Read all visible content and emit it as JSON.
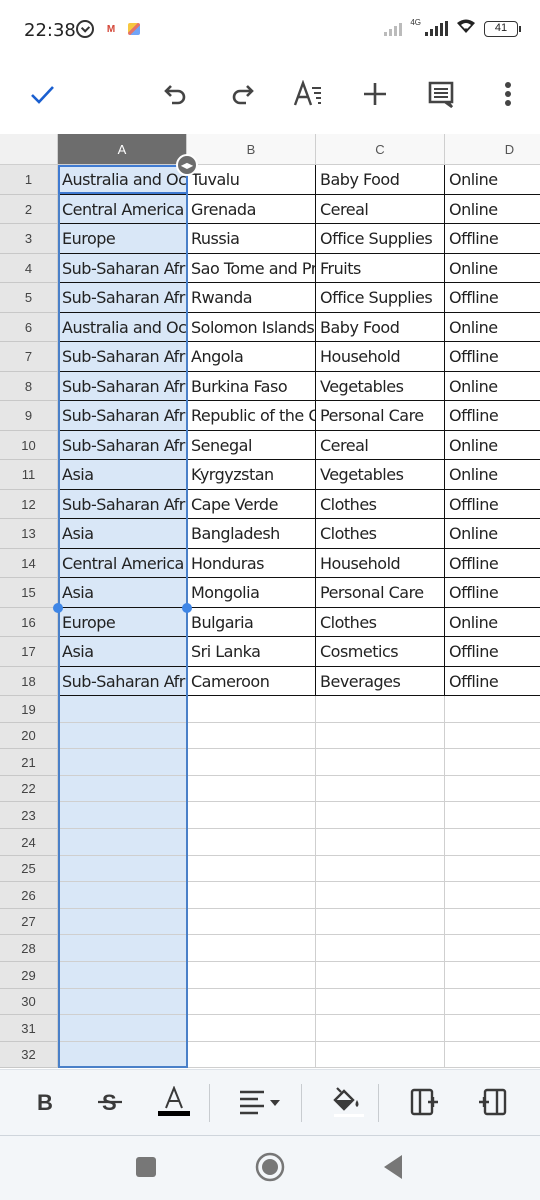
{
  "status_bar": {
    "time": "22:38",
    "network_label": "4G",
    "battery": "41",
    "icons": [
      "alarm-icon",
      "gmail-icon",
      "photos-icon",
      "signal-off-icon",
      "signal-4g-icon",
      "wifi-icon",
      "battery-icon"
    ]
  },
  "toolbar": {
    "icons": [
      "check-icon",
      "undo-icon",
      "redo-icon",
      "text-format-icon",
      "insert-plus-icon",
      "comment-icon",
      "more-vert-icon"
    ]
  },
  "sheet": {
    "columns": [
      "A",
      "B",
      "C",
      "D"
    ],
    "selected_column": "A",
    "row_numbers": [
      "1",
      "2",
      "3",
      "4",
      "5",
      "6",
      "7",
      "8",
      "9",
      "10",
      "11",
      "12",
      "13",
      "14",
      "15",
      "16",
      "17",
      "18",
      "19",
      "20",
      "21",
      "22",
      "23",
      "24",
      "25",
      "26",
      "27",
      "28",
      "29",
      "30",
      "31",
      "32"
    ],
    "rows": [
      [
        "Australia and Oce",
        "Tuvalu",
        "Baby Food",
        "Online"
      ],
      [
        "Central America a",
        "Grenada",
        "Cereal",
        "Online"
      ],
      [
        "Europe",
        "Russia",
        "Office Supplies",
        "Offline"
      ],
      [
        "Sub-Saharan Afric",
        "Sao Tome and Pri",
        "Fruits",
        "Online"
      ],
      [
        "Sub-Saharan Afric",
        "Rwanda",
        "Office Supplies",
        "Offline"
      ],
      [
        "Australia and Oce",
        "Solomon Islands",
        "Baby Food",
        "Online"
      ],
      [
        "Sub-Saharan Afric",
        "Angola",
        "Household",
        "Offline"
      ],
      [
        "Sub-Saharan Afric",
        "Burkina Faso",
        "Vegetables",
        "Online"
      ],
      [
        "Sub-Saharan Afric",
        "Republic of the Co",
        "Personal Care",
        "Offline"
      ],
      [
        "Sub-Saharan Afric",
        "Senegal",
        "Cereal",
        "Online"
      ],
      [
        "Asia",
        "Kyrgyzstan",
        "Vegetables",
        "Online"
      ],
      [
        "Sub-Saharan Afric",
        "Cape Verde",
        "Clothes",
        "Offline"
      ],
      [
        "Asia",
        "Bangladesh",
        "Clothes",
        "Online"
      ],
      [
        "Central America a",
        "Honduras",
        "Household",
        "Offline"
      ],
      [
        "Asia",
        "Mongolia",
        "Personal Care",
        "Offline"
      ],
      [
        "Europe",
        "Bulgaria",
        "Clothes",
        "Online"
      ],
      [
        "Asia",
        "Sri Lanka",
        "Cosmetics",
        "Offline"
      ],
      [
        "Sub-Saharan Afric",
        "Cameroon",
        "Beverages",
        "Offline"
      ]
    ]
  },
  "format_bar": {
    "icons": [
      "bold-icon",
      "strikethrough-icon",
      "text-color-icon",
      "align-icon",
      "fill-color-icon",
      "insert-column-right-icon",
      "insert-column-left-icon"
    ],
    "text_color": "#000000",
    "fill_color": "#ffffff"
  },
  "nav_bar": {
    "icons": [
      "recents-icon",
      "home-icon",
      "back-icon"
    ]
  },
  "colors": {
    "accent": "#1a73e8",
    "selection_fill": "#d9e7f7",
    "selection_border": "#4a80c8",
    "selected_header": "#6d6d6d"
  }
}
